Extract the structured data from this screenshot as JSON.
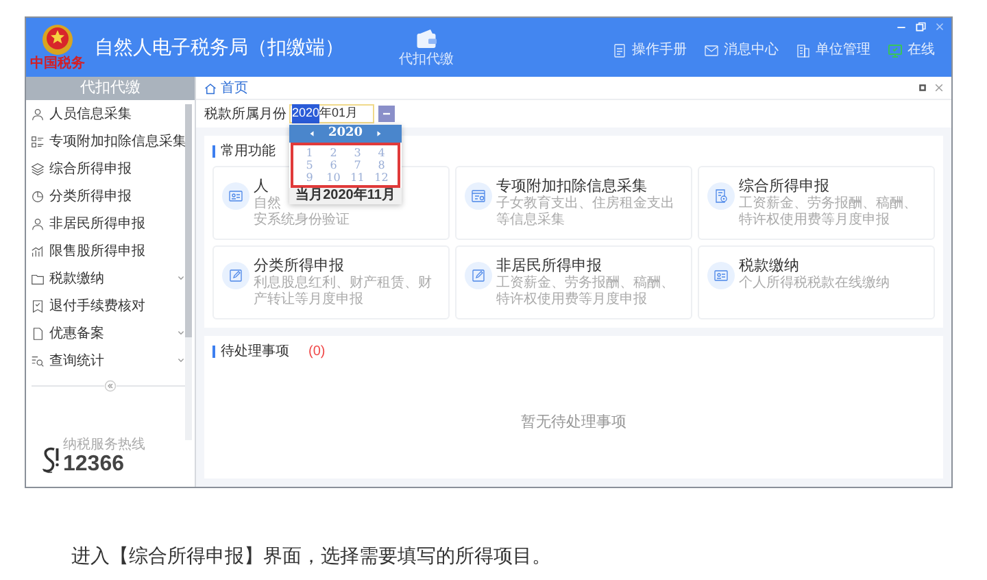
{
  "window": {
    "logo_text": "中国税务",
    "title": "自然人电子税务局（扣缴端）"
  },
  "nav": [
    {
      "label": "代扣代缴",
      "kind": "wallet"
    }
  ],
  "header_links": [
    {
      "label": "操作手册",
      "kind": "manual"
    },
    {
      "label": "消息中心",
      "kind": "mail"
    },
    {
      "label": "单位管理",
      "kind": "org"
    },
    {
      "label": "在线",
      "kind": "online"
    }
  ],
  "sidebar": {
    "title": "代扣代缴",
    "items": [
      {
        "label": "人员信息采集",
        "kind": "person",
        "expandable": false
      },
      {
        "label": "专项附加扣除信息采集",
        "kind": "list",
        "expandable": false
      },
      {
        "label": "综合所得申报",
        "kind": "layers",
        "expandable": false
      },
      {
        "label": "分类所得申报",
        "kind": "pie",
        "expandable": false
      },
      {
        "label": "非居民所得申报",
        "kind": "person",
        "expandable": false
      },
      {
        "label": "限售股所得申报",
        "kind": "bars",
        "expandable": false
      },
      {
        "label": "税款缴纳",
        "kind": "folder",
        "expandable": true
      },
      {
        "label": "退付手续费核对",
        "kind": "receipt",
        "expandable": false
      },
      {
        "label": "优惠备案",
        "kind": "doc",
        "expandable": true
      },
      {
        "label": "查询统计",
        "kind": "search",
        "expandable": true
      }
    ],
    "hotline": {
      "caption": "纳税服务热线",
      "number": "12366"
    }
  },
  "breadcrumb": "首页",
  "period_field": {
    "label": "税款所属月份",
    "value_selected": "2020",
    "value_rest": "年01月"
  },
  "month_picker": {
    "year": "2020",
    "months": [
      "1",
      "2",
      "3",
      "4",
      "5",
      "6",
      "7",
      "8",
      "9",
      "10",
      "11",
      "12"
    ],
    "footer": "当月2020年11月"
  },
  "common_functions": {
    "title": "常用功能",
    "cards": [
      {
        "title": "人",
        "description": [
          "自然",
          "安系统身份验证"
        ],
        "kind": "idcard"
      },
      {
        "title": "专项附加扣除信息采集",
        "description": [
          "子女教育支出、住房租金支出等信息采集"
        ],
        "kind": "form"
      },
      {
        "title": "综合所得申报",
        "description": [
          "工资薪金、劳务报酬、稿酬、特许权使用费等月度申报"
        ],
        "kind": "docgear"
      },
      {
        "title": "分类所得申报",
        "description": [
          "利息股息红利、财产租赁、财产转让等月度申报"
        ],
        "kind": "edit"
      },
      {
        "title": "非居民所得申报",
        "description": [
          "工资薪金、劳务报酬、稿酬、特许权使用费等月度申报"
        ],
        "kind": "edit"
      },
      {
        "title": "税款缴纳",
        "description": [
          "个人所得税税款在线缴纳"
        ],
        "kind": "idcard"
      }
    ]
  },
  "pending": {
    "title": "待处理事项",
    "count": "(0)",
    "empty_text": "暂无待处理事项"
  },
  "caption": "进入【综合所得申报】界面，选择需要填写的所得项目。"
}
